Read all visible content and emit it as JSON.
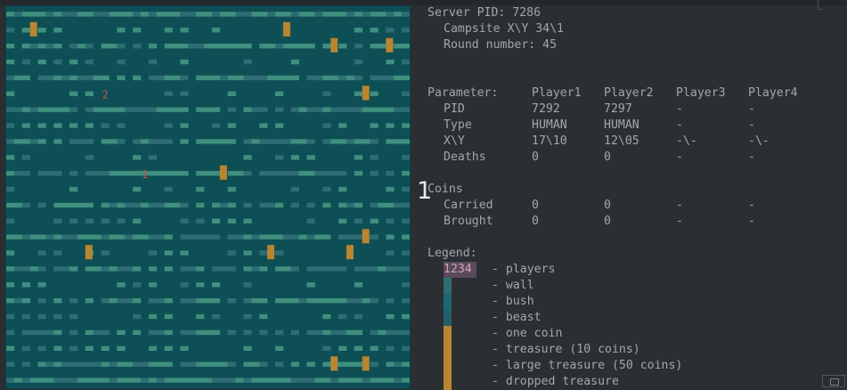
{
  "server": {
    "pid_line": "Server PID: 7286",
    "campsite_line": "Campsite X\\Y 34\\1",
    "round_line": "Round number: 45"
  },
  "params": {
    "header": [
      "Parameter:",
      "Player1",
      "Player2",
      "Player3",
      "Player4"
    ],
    "rows": [
      [
        "PID",
        "7292",
        "7297",
        "-",
        "-"
      ],
      [
        "Type",
        "HUMAN",
        "HUMAN",
        "-",
        "-"
      ],
      [
        "X\\Y",
        "17\\10",
        "12\\05",
        "-\\-",
        "-\\-"
      ],
      [
        "Deaths",
        "0",
        "0",
        "-",
        "-"
      ]
    ]
  },
  "coins": {
    "title": "Coins",
    "rows": [
      [
        "Carried",
        "0",
        "0",
        "-",
        "-"
      ],
      [
        "Brought",
        "0",
        "0",
        "-",
        "-"
      ]
    ]
  },
  "cursor_char": "1",
  "legend": {
    "title": "Legend:",
    "players_swatch": "1234",
    "items": [
      "- players",
      "- wall",
      "- bush",
      "- beast",
      "- one coin",
      "- treasure (10 coins)",
      "- large treasure (50 coins)",
      "- dropped treasure"
    ]
  },
  "maze": {
    "player_markers": [
      "1",
      "2"
    ],
    "colors": {
      "floor": "#0e4f56",
      "wall": "#2e6d73",
      "bush": "#3f8f7e",
      "coin": "#b9852f",
      "player": "#c94f4f"
    }
  }
}
